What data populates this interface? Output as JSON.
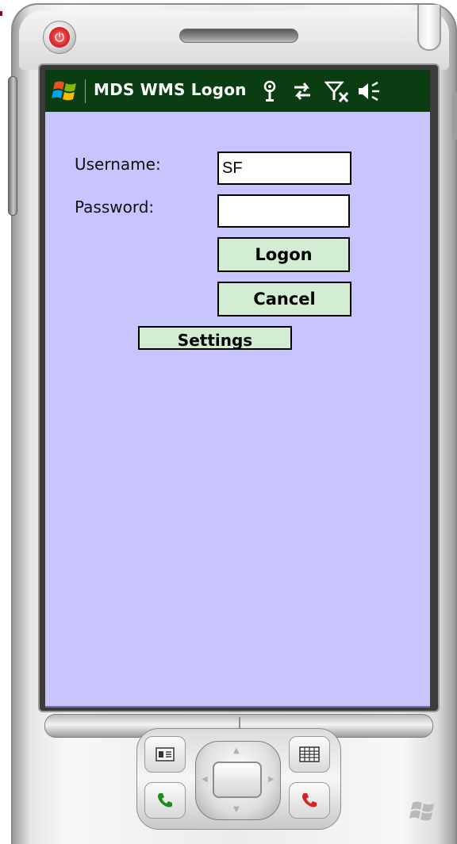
{
  "window": {
    "title": "MDS WMS Logon"
  },
  "status_icons": [
    "antenna-icon",
    "sync-arrows-icon",
    "no-signal-icon",
    "speaker-icon"
  ],
  "form": {
    "username_label": "Username:",
    "username_value": "SF",
    "password_label": "Password:",
    "password_value": ""
  },
  "buttons": {
    "logon": "Logon",
    "cancel": "Cancel",
    "settings": "Settings"
  },
  "colors": {
    "title_bar": "#0a3d12",
    "screen_background": "#c8c4fd",
    "button_background": "#d2edd2",
    "power_button": "#d42020"
  }
}
